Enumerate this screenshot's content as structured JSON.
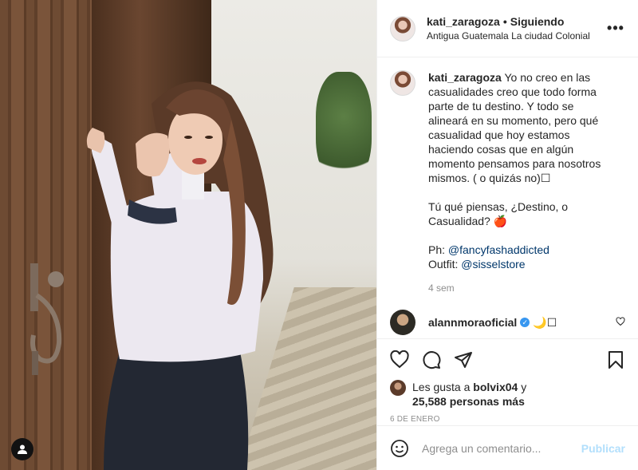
{
  "post": {
    "username": "kati_zaragoza",
    "separator": "•",
    "follow_status": "Siguiendo",
    "location": "Antigua Guatemala La ciudad Colonial",
    "more_label": "•••"
  },
  "caption": {
    "username": "kati_zaragoza",
    "paragraph_1": " Yo no creo en las casualidades creo que todo forma parte de tu destino. Y todo se alineará en su momento, pero qué casualidad que hoy estamos haciendo cosas que en algún momento pensamos para nosotros mismos. ( o quizás no)☐",
    "paragraph_2": "Tú qué piensas, ¿Destino, o Casualidad? 🍎",
    "credit_photo_label": "Ph: ",
    "credit_photo_link": "@fancyfashaddicted",
    "credit_outfit_label": "Outfit: ",
    "credit_outfit_link": "@sisselstore",
    "time_ago": "4 sem"
  },
  "reply": {
    "username": "alannmoraoficial",
    "verified_mark": "✓",
    "text": "🌙☐"
  },
  "likes": {
    "prefix": "Les gusta a ",
    "first_liker": "bolvix04",
    "connector": " y",
    "others": "25,588 personas más"
  },
  "date": "6 DE ENERO",
  "comment_box": {
    "placeholder": "Agrega un comentario...",
    "publish_label": "Publicar"
  },
  "colors": {
    "link": "#00376b",
    "publish_disabled": "#b2dffc",
    "verified": "#3897f0",
    "secondary_text": "#8e8e8e"
  },
  "icons": [
    "heart-icon",
    "comment-icon",
    "share-icon",
    "bookmark-icon",
    "emoji-icon",
    "user-tag-icon",
    "more-icon"
  ]
}
